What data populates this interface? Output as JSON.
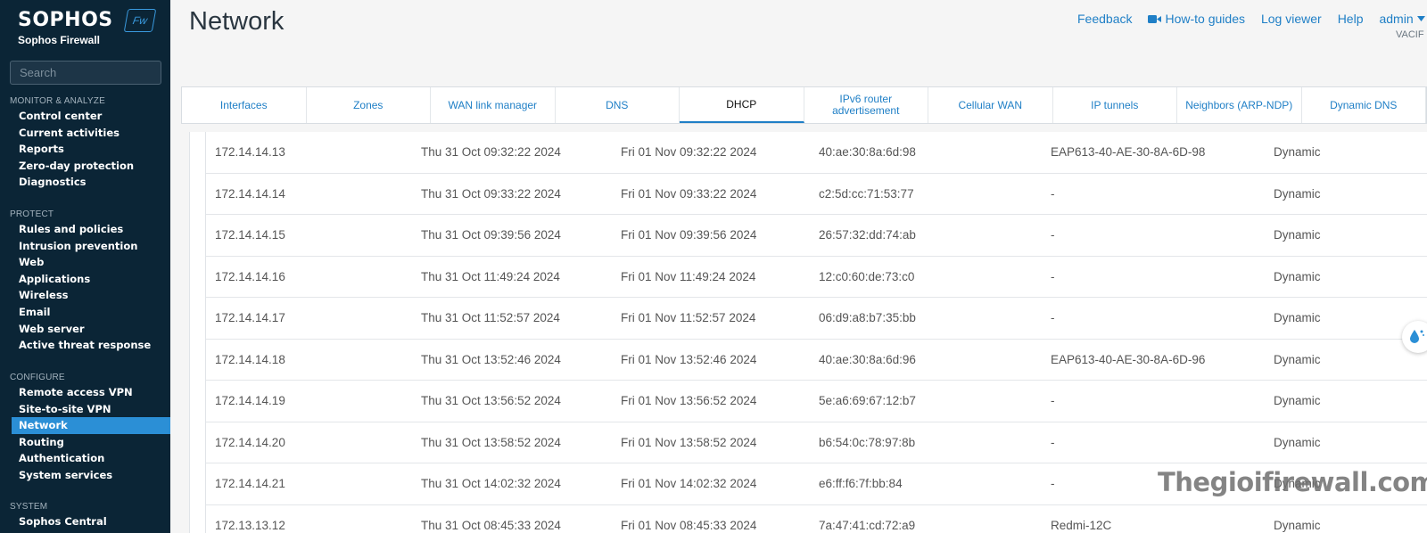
{
  "brand": {
    "name": "SOPHOS",
    "subtitle": "Sophos Firewall",
    "badge": "Fw",
    "accent": "#3a9be0"
  },
  "search": {
    "placeholder": "Search"
  },
  "sidebar": {
    "sections": [
      {
        "heading": "MONITOR & ANALYZE",
        "items": [
          "Control center",
          "Current activities",
          "Reports",
          "Zero-day protection",
          "Diagnostics"
        ]
      },
      {
        "heading": "PROTECT",
        "items": [
          "Rules and policies",
          "Intrusion prevention",
          "Web",
          "Applications",
          "Wireless",
          "Email",
          "Web server",
          "Active threat response"
        ]
      },
      {
        "heading": "CONFIGURE",
        "items": [
          "Remote access VPN",
          "Site-to-site VPN",
          "Network",
          "Routing",
          "Authentication",
          "System services"
        ]
      },
      {
        "heading": "SYSTEM",
        "items": [
          "Sophos Central"
        ]
      }
    ],
    "active_item": "Network",
    "background": "#0b2536",
    "active_color": "#2b8fd6"
  },
  "header": {
    "title": "Network",
    "links": {
      "feedback": "Feedback",
      "howto": "How-to guides",
      "logviewer": "Log viewer",
      "help": "Help",
      "user": "admin"
    },
    "user_sub": "VACIF"
  },
  "tabs": {
    "items": [
      "Interfaces",
      "Zones",
      "WAN link manager",
      "DNS",
      "DHCP",
      "IPv6 router advertisement",
      "Cellular WAN",
      "IP tunnels",
      "Neighbors (ARP-NDP)",
      "Dynamic DNS"
    ],
    "active": "DHCP"
  },
  "leases": [
    {
      "ip": "172.14.14.13",
      "start": "Thu 31 Oct 09:32:22 2024",
      "end": "Fri 01 Nov 09:32:22 2024",
      "mac": "40:ae:30:8a:6d:98",
      "host": "EAP613-40-AE-30-8A-6D-98",
      "type": "Dynamic"
    },
    {
      "ip": "172.14.14.14",
      "start": "Thu 31 Oct 09:33:22 2024",
      "end": "Fri 01 Nov 09:33:22 2024",
      "mac": "c2:5d:cc:71:53:77",
      "host": "-",
      "type": "Dynamic"
    },
    {
      "ip": "172.14.14.15",
      "start": "Thu 31 Oct 09:39:56 2024",
      "end": "Fri 01 Nov 09:39:56 2024",
      "mac": "26:57:32:dd:74:ab",
      "host": "-",
      "type": "Dynamic"
    },
    {
      "ip": "172.14.14.16",
      "start": "Thu 31 Oct 11:49:24 2024",
      "end": "Fri 01 Nov 11:49:24 2024",
      "mac": "12:c0:60:de:73:c0",
      "host": "-",
      "type": "Dynamic"
    },
    {
      "ip": "172.14.14.17",
      "start": "Thu 31 Oct 11:52:57 2024",
      "end": "Fri 01 Nov 11:52:57 2024",
      "mac": "06:d9:a8:b7:35:bb",
      "host": "-",
      "type": "Dynamic"
    },
    {
      "ip": "172.14.14.18",
      "start": "Thu 31 Oct 13:52:46 2024",
      "end": "Fri 01 Nov 13:52:46 2024",
      "mac": "40:ae:30:8a:6d:96",
      "host": "EAP613-40-AE-30-8A-6D-96",
      "type": "Dynamic"
    },
    {
      "ip": "172.14.14.19",
      "start": "Thu 31 Oct 13:56:52 2024",
      "end": "Fri 01 Nov 13:56:52 2024",
      "mac": "5e:a6:69:67:12:b7",
      "host": "-",
      "type": "Dynamic"
    },
    {
      "ip": "172.14.14.20",
      "start": "Thu 31 Oct 13:58:52 2024",
      "end": "Fri 01 Nov 13:58:52 2024",
      "mac": "b6:54:0c:78:97:8b",
      "host": "-",
      "type": "Dynamic"
    },
    {
      "ip": "172.14.14.21",
      "start": "Thu 31 Oct 14:02:32 2024",
      "end": "Fri 01 Nov 14:02:32 2024",
      "mac": "e6:ff:f6:7f:bb:84",
      "host": "-",
      "type": "Dynamic"
    },
    {
      "ip": "172.13.13.12",
      "start": "Thu 31 Oct 08:45:33 2024",
      "end": "Fri 01 Nov 08:45:33 2024",
      "mac": "7a:47:41:cd:72:a9",
      "host": "Redmi-12C",
      "type": "Dynamic"
    }
  ],
  "watermark": "Thegioifirewall.com",
  "link_color": "#1f7fc6"
}
